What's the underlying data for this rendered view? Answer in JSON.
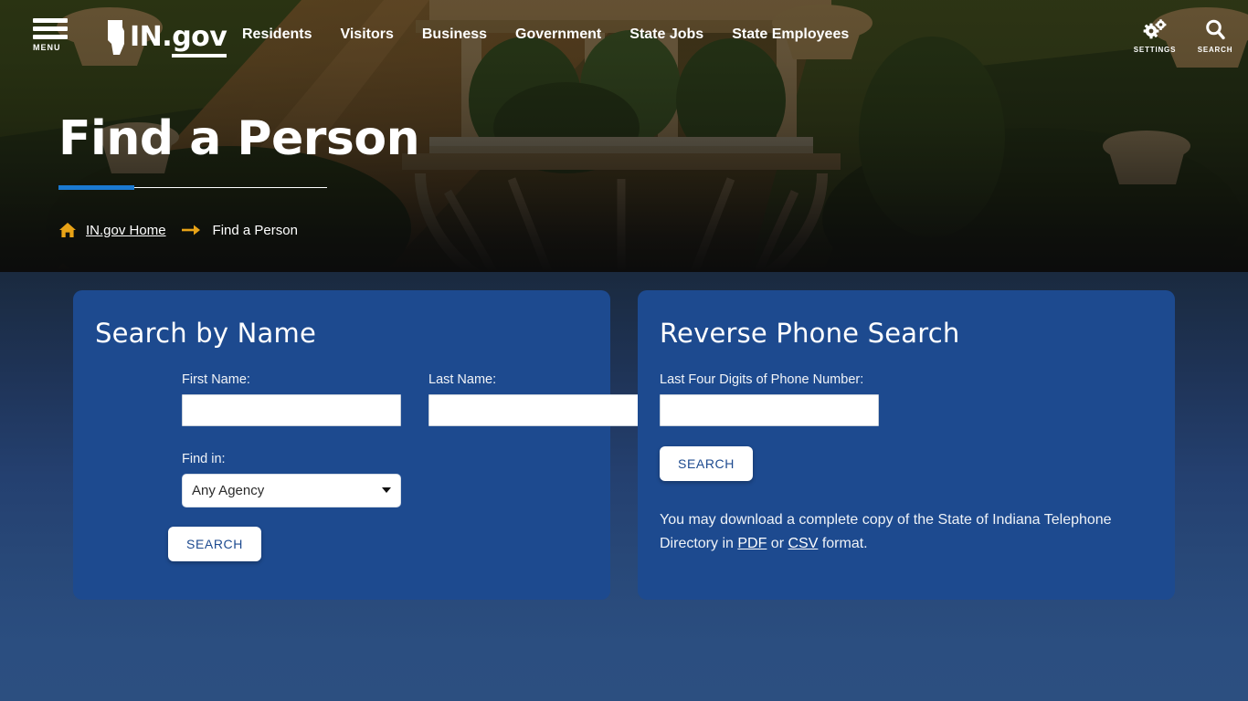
{
  "site": {
    "logo_text": "IN",
    "logo_dot": ".",
    "logo_gov": "gov",
    "menu_label": "MENU"
  },
  "nav": {
    "items": [
      {
        "label": "Residents"
      },
      {
        "label": "Visitors"
      },
      {
        "label": "Business"
      },
      {
        "label": "Government"
      },
      {
        "label": "State Jobs"
      },
      {
        "label": "State Employees"
      }
    ]
  },
  "utility": {
    "settings_label": "SETTINGS",
    "search_label": "SEARCH"
  },
  "hero": {
    "title": "Find a Person",
    "accent_color": "#1b7ad1",
    "rule_color": "#ffffff"
  },
  "breadcrumb": {
    "home_label": "IN.gov Home",
    "current": "Find a Person",
    "arrow_color": "#e8a317",
    "home_icon_color": "#e8a317"
  },
  "cards": {
    "name_search": {
      "title": "Search by Name",
      "first_name_label": "First Name:",
      "first_name_value": "",
      "last_name_label": "Last Name:",
      "last_name_value": "",
      "find_in_label": "Find in:",
      "find_in_selected": "Any Agency",
      "search_button": "SEARCH"
    },
    "phone_search": {
      "title": "Reverse Phone Search",
      "phone_label": "Last Four Digits of Phone Number:",
      "phone_value": "",
      "search_button": "SEARCH",
      "note_prefix": "You may download a complete copy of the State of Indiana Telephone Directory in ",
      "note_pdf": "PDF",
      "note_middle": " or ",
      "note_csv": "CSV",
      "note_suffix": " format."
    },
    "card_color": "#1d4a8f"
  }
}
